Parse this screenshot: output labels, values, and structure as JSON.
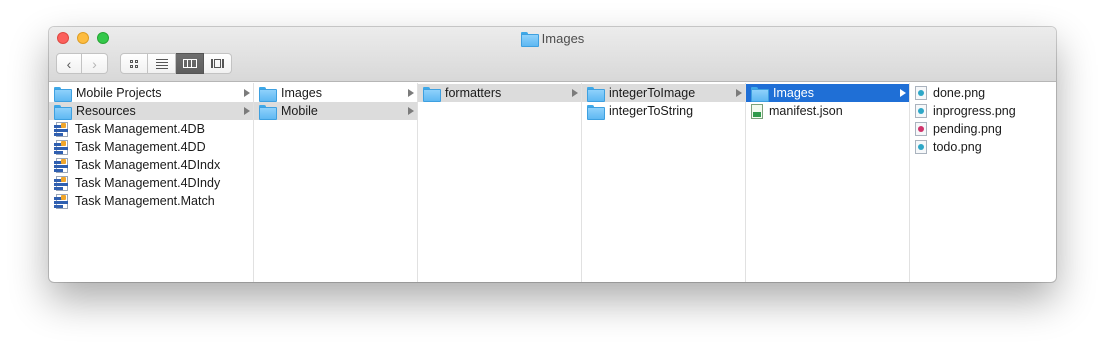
{
  "window": {
    "title": "Images"
  },
  "toolbar": {
    "back_label": "‹",
    "forward_label": "›",
    "views": [
      "icon-view",
      "list-view",
      "column-view",
      "cover-flow-view"
    ],
    "active_view": "column-view"
  },
  "colors": {
    "selection_blue": "#1f6fd6",
    "selection_gray": "#dcdcdc",
    "folder": "#5fb8f2",
    "png_done": "#2ea7c7",
    "png_pending": "#d0336b"
  },
  "columns": [
    {
      "items": [
        {
          "label": "Mobile Projects",
          "icon": "folder-icon",
          "arrow": true,
          "state": ""
        },
        {
          "label": "Resources",
          "icon": "folder-icon",
          "arrow": true,
          "state": "gray"
        },
        {
          "label": "Task Management.4DB",
          "icon": "4d-document-icon",
          "arrow": false,
          "state": ""
        },
        {
          "label": "Task Management.4DD",
          "icon": "4d-document-icon",
          "arrow": false,
          "state": ""
        },
        {
          "label": "Task Management.4DIndx",
          "icon": "4d-document-icon",
          "arrow": false,
          "state": ""
        },
        {
          "label": "Task Management.4DIndy",
          "icon": "4d-document-icon",
          "arrow": false,
          "state": ""
        },
        {
          "label": "Task Management.Match",
          "icon": "4d-document-icon",
          "arrow": false,
          "state": ""
        }
      ]
    },
    {
      "items": [
        {
          "label": "Images",
          "icon": "folder-icon",
          "arrow": true,
          "state": ""
        },
        {
          "label": "Mobile",
          "icon": "folder-icon",
          "arrow": true,
          "state": "gray"
        }
      ]
    },
    {
      "items": [
        {
          "label": "formatters",
          "icon": "folder-icon",
          "arrow": true,
          "state": "gray"
        }
      ]
    },
    {
      "items": [
        {
          "label": "integerToImage",
          "icon": "folder-icon",
          "arrow": true,
          "state": "gray"
        },
        {
          "label": "integerToString",
          "icon": "folder-icon",
          "arrow": false,
          "state": ""
        }
      ]
    },
    {
      "items": [
        {
          "label": "Images",
          "icon": "folder-icon",
          "arrow": true,
          "state": "blue"
        },
        {
          "label": "manifest.json",
          "icon": "json-file-icon",
          "arrow": false,
          "state": ""
        }
      ]
    },
    {
      "items": [
        {
          "label": "done.png",
          "icon": "png-file-icon",
          "arrow": false,
          "state": ""
        },
        {
          "label": "inprogress.png",
          "icon": "png-file-icon",
          "arrow": false,
          "state": ""
        },
        {
          "label": "pending.png",
          "icon": "png-file-icon-pending",
          "arrow": false,
          "state": ""
        },
        {
          "label": "todo.png",
          "icon": "png-file-icon",
          "arrow": false,
          "state": ""
        }
      ]
    }
  ]
}
